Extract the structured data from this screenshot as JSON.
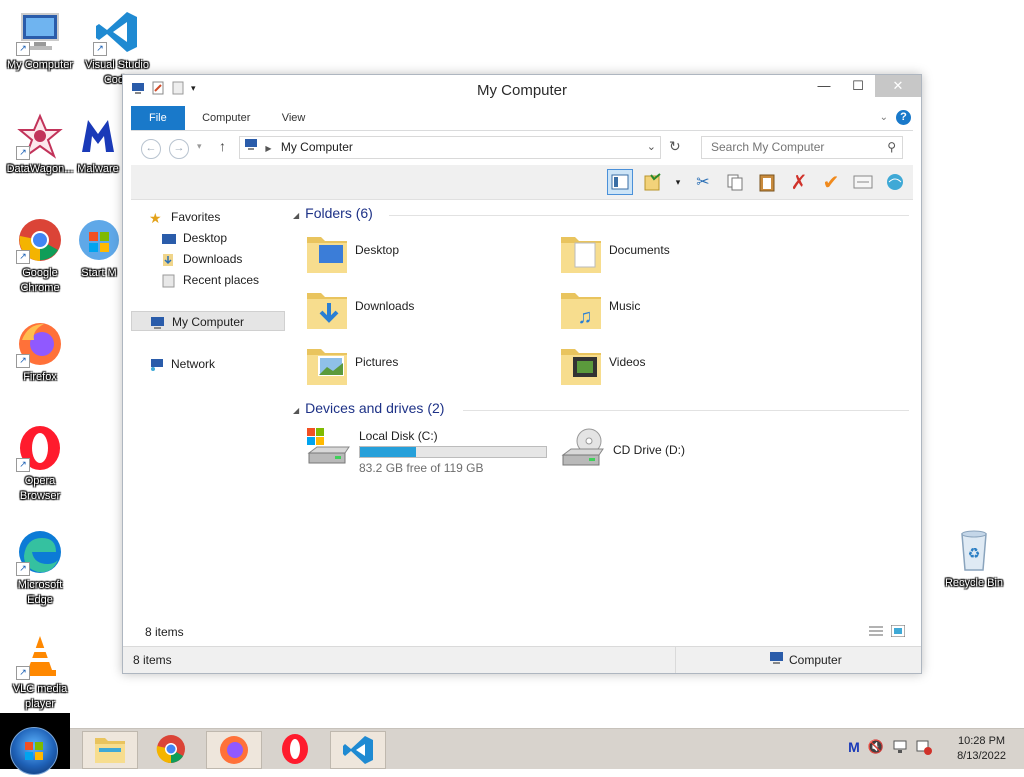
{
  "desktop": {
    "icons": [
      {
        "label": "My Computer",
        "name": "my-computer-desktop-icon"
      },
      {
        "label": "Visual Studio\nCode",
        "name": "vscode-desktop-icon"
      },
      {
        "label": "DataWagon...",
        "name": "datawagon-desktop-icon"
      },
      {
        "label": "Malware",
        "name": "malwarebytes-desktop-icon"
      },
      {
        "label": "Google\nChrome",
        "name": "chrome-desktop-icon"
      },
      {
        "label": "Start M",
        "name": "start-menu-desktop-icon"
      },
      {
        "label": "Firefox",
        "name": "firefox-desktop-icon"
      },
      {
        "label": "Opera\nBrowser",
        "name": "opera-desktop-icon"
      },
      {
        "label": "Microsoft\nEdge",
        "name": "edge-desktop-icon"
      },
      {
        "label": "VLC media\nplayer",
        "name": "vlc-desktop-icon"
      },
      {
        "label": "Recycle Bin",
        "name": "recycle-bin-desktop-icon"
      }
    ]
  },
  "window": {
    "title": "My Computer",
    "close_glyph": "✕",
    "minimize_glyph": "—",
    "maximize_glyph": "☐",
    "ribbon_tabs": [
      "File",
      "Computer",
      "View"
    ],
    "help_glyph": "?",
    "address": {
      "path": "My Computer"
    },
    "search": {
      "placeholder": "Search My Computer"
    },
    "nav": {
      "favorites": "Favorites",
      "desktop": "Desktop",
      "downloads": "Downloads",
      "recent": "Recent places",
      "my_computer": "My Computer",
      "network": "Network"
    },
    "folders_header": "Folders (6)",
    "folders": [
      "Desktop",
      "Documents",
      "Downloads",
      "Music",
      "Pictures",
      "Videos"
    ],
    "drives_header": "Devices and drives (2)",
    "drives": [
      {
        "name": "Local Disk (C:)",
        "free": "83.2 GB free of 119 GB",
        "used_fraction": 0.3
      },
      {
        "name": "CD Drive (D:)"
      }
    ],
    "item_count": "8 items",
    "status_count": "8 items",
    "status_location": "Computer"
  },
  "taskbar": {
    "time": "10:28 PM",
    "date": "8/13/2022"
  },
  "colors": {
    "accent": "#1979ca",
    "drive_bar": "#26a0da"
  }
}
